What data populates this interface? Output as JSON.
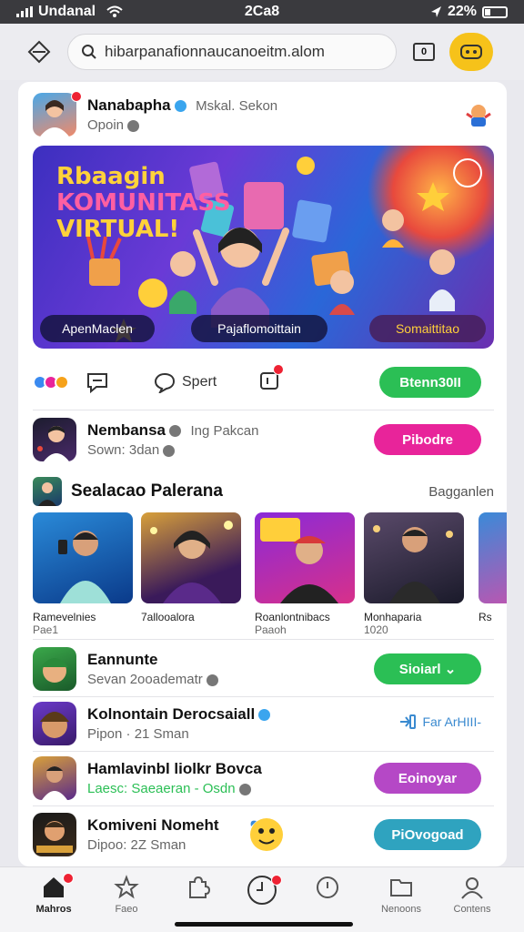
{
  "status": {
    "carrier": "Undanal",
    "time": "2Ca8",
    "battery": "22%"
  },
  "browser": {
    "url": "hibarpanafionnaucanoeitm.alom"
  },
  "feed_header": {
    "name": "Nanabapha",
    "handle": "Mskal. Sekon",
    "sub": "Opoin"
  },
  "hero": {
    "title_lines": [
      "Rbaagin",
      "KOMUNITASS",
      "VIRTUAL!"
    ],
    "chips": [
      "ApenMaclen",
      "Pajaflomoittain",
      "Somaittitao"
    ]
  },
  "actions": {
    "share_label": "Spert",
    "primary_button": "Btenn30II"
  },
  "post2": {
    "name": "Nembansa",
    "meta": "Ing Pakcan",
    "sub": "Sown: 3dan",
    "button": "Pibodre"
  },
  "recommended": {
    "title": "Sealacao Palerana",
    "more": "Bagganlen",
    "items": [
      {
        "name": "Ramevelnies",
        "meta": "Pae1"
      },
      {
        "name": "7allooalora",
        "meta": ""
      },
      {
        "name": "Roanlontnibacs",
        "meta": "Paaoh"
      },
      {
        "name": "Monhaparia",
        "meta": "1020"
      },
      {
        "name": "Rs",
        "meta": ""
      }
    ]
  },
  "rows": [
    {
      "name": "Eannunte",
      "sub": "Sevan  2ooadematr",
      "button": "Sioiarl",
      "button_color": "#2bbf55"
    },
    {
      "name": "Kolnontain Derocsaiall",
      "sub": "Pipon · 21 Sman",
      "button": "Far ArHIII-",
      "button_color": "transparent"
    },
    {
      "name": "Hamlavinbl liolkr Bovca",
      "sub": "Laesc: Saeaeran - Osdn",
      "button": "Eoinoyar",
      "button_color": "#b548c6"
    },
    {
      "name": "Komiveni  Nomeht",
      "sub": "Dipoo: 2Z Sman",
      "button": "PiOvogoad",
      "button_color": "#2fa3bf"
    }
  ],
  "bottom_nav": [
    {
      "label": "Mahros",
      "icon": "home-icon"
    },
    {
      "label": "Faeo",
      "icon": "star-icon"
    },
    {
      "label": "",
      "icon": "puzzle-icon"
    },
    {
      "label": "",
      "icon": "clock-icon"
    },
    {
      "label": "",
      "icon": "chat-icon"
    },
    {
      "label": "Nenoons",
      "icon": "folder-icon"
    },
    {
      "label": "Contens",
      "icon": "profile-icon"
    }
  ],
  "colors": {
    "green": "#2bbf55",
    "pink": "#e8249a",
    "purple": "#b548c6",
    "teal": "#2fa3bf",
    "yellow": "#f6c21a"
  }
}
